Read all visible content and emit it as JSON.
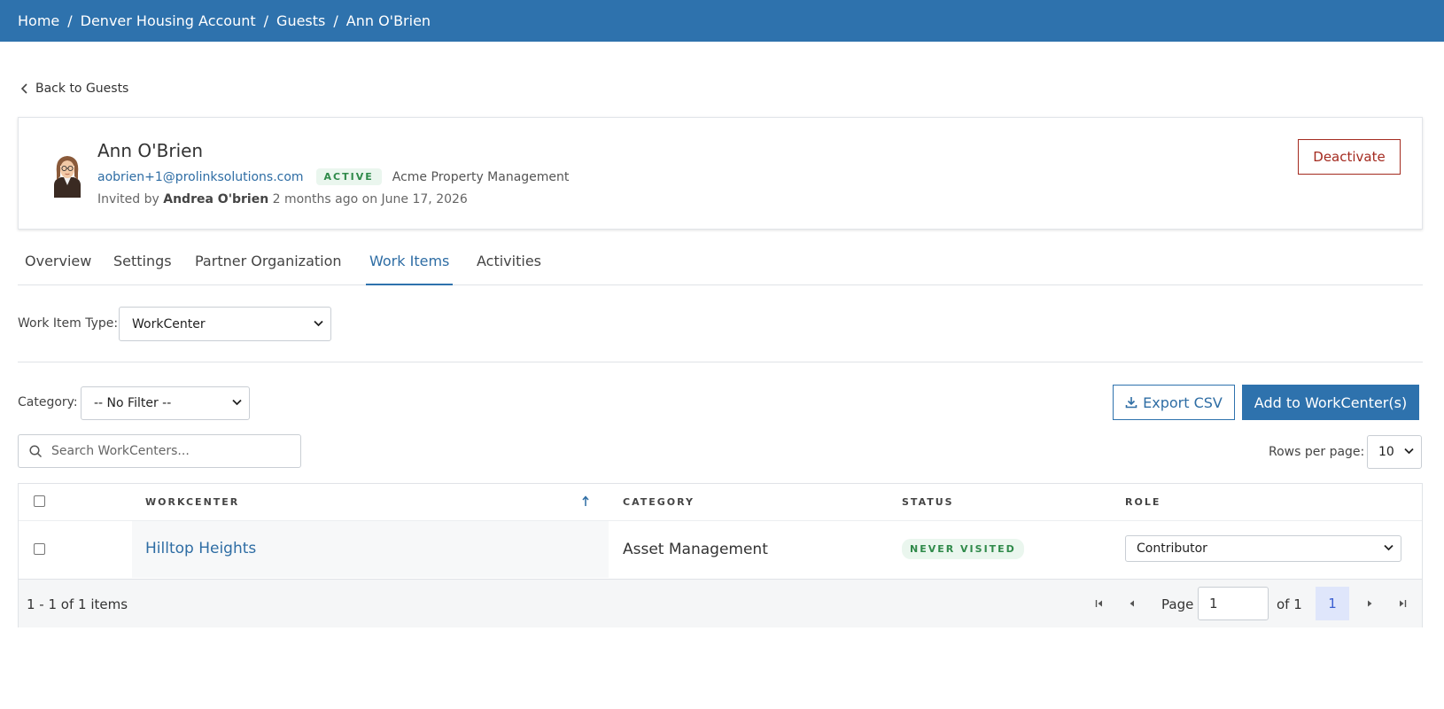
{
  "breadcrumb": {
    "items": [
      "Home",
      "Denver Housing Account",
      "Guests",
      "Ann O'Brien"
    ],
    "separator": "/"
  },
  "back_link": {
    "label": "Back to Guests"
  },
  "profile": {
    "name": "Ann O'Brien",
    "email": "aobrien+1@prolinksolutions.com",
    "status": "ACTIVE",
    "organization": "Acme Property Management",
    "invited_prefix": "Invited by",
    "invited_by": "Andrea O'brien",
    "invited_suffix": "2 months ago on June 17, 2026",
    "deactivate_label": "Deactivate"
  },
  "tabs": [
    {
      "label": "Overview",
      "active": false
    },
    {
      "label": "Settings",
      "active": false
    },
    {
      "label": "Partner Organization",
      "active": false
    },
    {
      "label": "Work Items",
      "active": true
    },
    {
      "label": "Activities",
      "active": false
    }
  ],
  "filters": {
    "work_item_type_label": "Work Item Type:",
    "work_item_type_value": "WorkCenter",
    "category_label": "Category:",
    "category_value": "-- No Filter --"
  },
  "actions": {
    "export_label": "Export CSV",
    "add_label": "Add to WorkCenter(s)"
  },
  "search": {
    "placeholder": "Search WorkCenters..."
  },
  "rows_per_page": {
    "label": "Rows per page:",
    "value": "10"
  },
  "table": {
    "columns": [
      "WORKCENTER",
      "CATEGORY",
      "STATUS",
      "ROLE"
    ],
    "sort_column": "WORKCENTER",
    "sort_direction": "ascending",
    "rows": [
      {
        "workcenter": "Hilltop Heights",
        "category": "Asset Management",
        "status": "NEVER VISITED",
        "role": "Contributor"
      }
    ]
  },
  "pagination": {
    "summary": "1 - 1 of 1 items",
    "page_label": "Page",
    "page_value": "1",
    "of_label": "of 1",
    "current_page": "1"
  },
  "colors": {
    "header_bg": "#2e72ad",
    "link": "#2e6da4",
    "danger": "#a42a1f",
    "success_text": "#2f8a4a",
    "success_bg": "#eaf6ee"
  },
  "icons": {
    "back": "chevron-left-icon",
    "export": "download-icon",
    "search": "search-icon",
    "sort": "arrow-up-icon",
    "first": "first-page-icon",
    "prev": "prev-page-icon",
    "next": "next-page-icon",
    "last": "last-page-icon",
    "dropdown": "chevron-down-icon"
  }
}
